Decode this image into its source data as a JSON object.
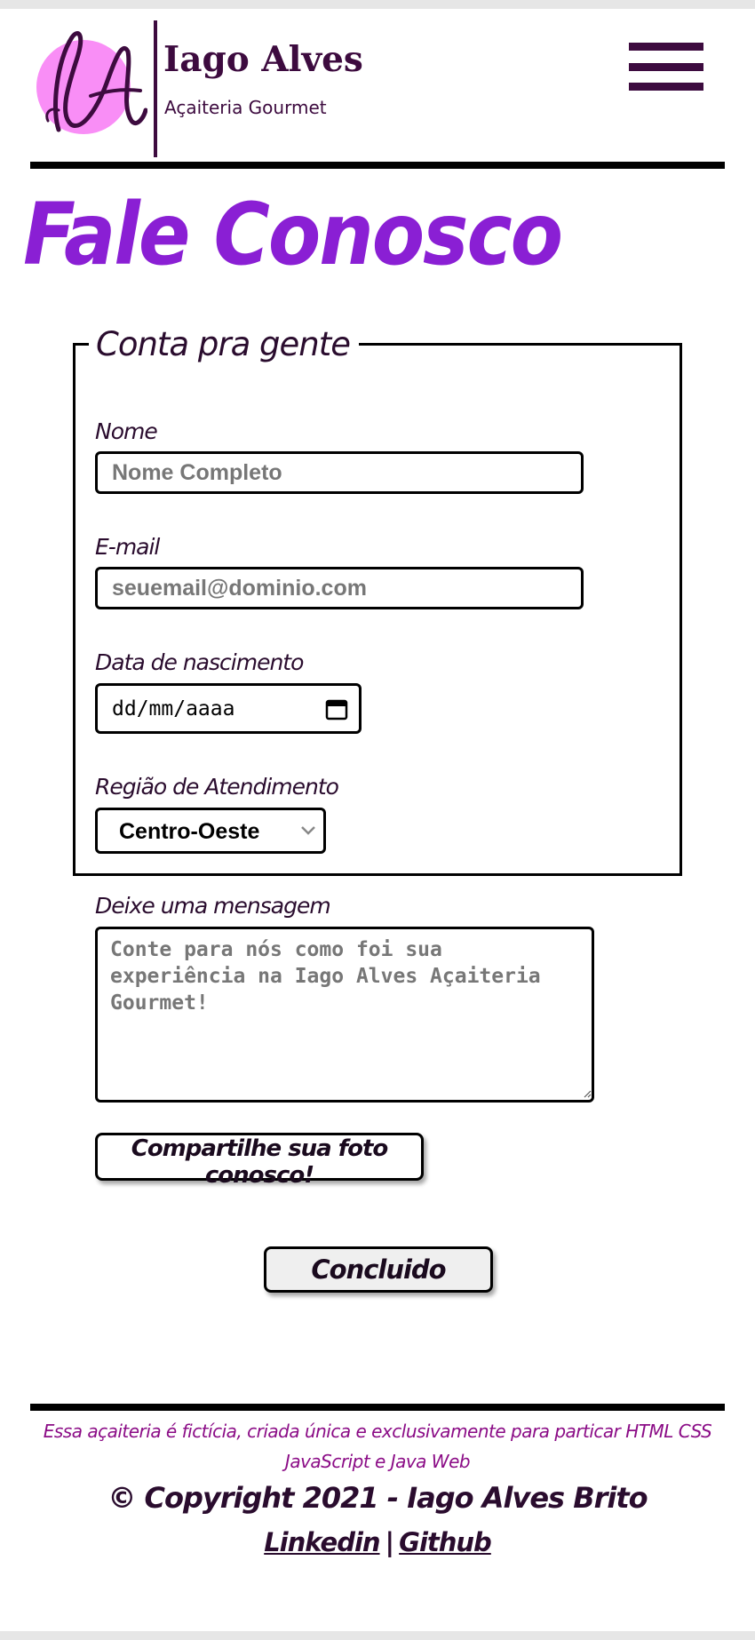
{
  "header": {
    "brand_name": "Iago Alves",
    "brand_subtitle": "Açaiteria Gourmet",
    "logo_initials": "IA"
  },
  "page_title": "Fale Conosco",
  "form": {
    "legend": "Conta pra gente",
    "name": {
      "label": "Nome",
      "placeholder": "Nome Completo",
      "value": ""
    },
    "email": {
      "label": "E-mail",
      "placeholder": "seuemail@dominio.com",
      "value": ""
    },
    "birthdate": {
      "label": "Data de nascimento",
      "value": "dd/mm/aaaa"
    },
    "region": {
      "label": "Região de Atendimento",
      "selected": "Centro-Oeste"
    },
    "message": {
      "label": "Deixe uma mensagem",
      "placeholder": "Conte para nós como foi sua experiência na Iago Alves Açaiteria Gourmet!"
    },
    "upload_label": "Compartilhe sua foto conosco!",
    "submit_label": "Concluido"
  },
  "footer": {
    "note": "Essa açaiteria é fictícia, criada única e exclusivamente para particar HTML CSS JavaScript e Java Web",
    "copyright": "© Copyright 2021 - Iago Alves Brito",
    "links": [
      {
        "label": "Linkedin"
      },
      {
        "label": "Github"
      }
    ],
    "separator": "|"
  },
  "colors": {
    "brand_dark": "#3d0b3f",
    "title_purple": "#8a1fd4",
    "logo_pink": "#f98ef6",
    "footer_note": "#8b0c86"
  },
  "icons": [
    "hamburger-menu-icon",
    "calendar-icon",
    "chevron-down-icon"
  ]
}
